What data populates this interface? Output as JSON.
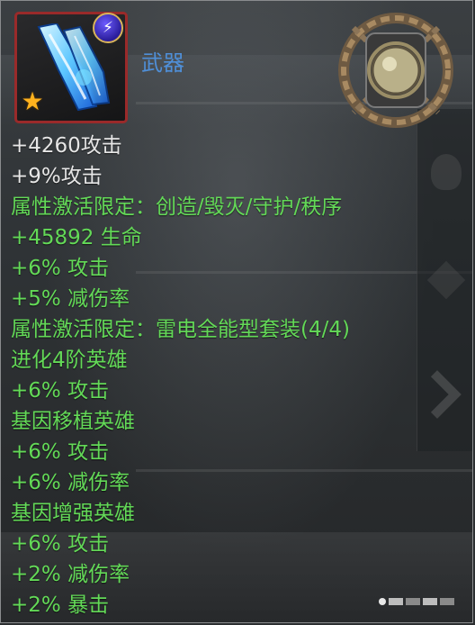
{
  "item": {
    "type_label": "武器",
    "icon": "lightning-blade-weapon-icon",
    "element_badge": "lightning-element-icon",
    "rarity_badge": "gold-star-icon",
    "emblem": "chained-orb-emblem-icon"
  },
  "stats": [
    {
      "text": "+4260攻击",
      "color": "white"
    },
    {
      "text": "+9%攻击",
      "color": "white"
    },
    {
      "text": "属性激活限定：创造/毁灭/守护/秩序",
      "color": "green"
    },
    {
      "text": "+45892 生命",
      "color": "green"
    },
    {
      "text": "+6% 攻击",
      "color": "green"
    },
    {
      "text": "+5% 减伤率",
      "color": "green"
    },
    {
      "text": "属性激活限定：雷电全能型套装(4/4)",
      "color": "green"
    },
    {
      "text": "进化4阶英雄",
      "color": "green"
    },
    {
      "text": "+6% 攻击",
      "color": "green"
    },
    {
      "text": "基因移植英雄",
      "color": "green"
    },
    {
      "text": "+6% 攻击",
      "color": "green"
    },
    {
      "text": "+6% 减伤率",
      "color": "green"
    },
    {
      "text": "基因增强英雄",
      "color": "green"
    },
    {
      "text": "+6% 攻击",
      "color": "green"
    },
    {
      "text": "+2% 减伤率",
      "color": "green"
    },
    {
      "text": "+2% 暴击",
      "color": "green"
    }
  ],
  "colors": {
    "white_stat": "#e6e6e6",
    "green_stat": "#63d957",
    "type_label": "#4f8fd8",
    "icon_border": "#9a2a2a"
  }
}
